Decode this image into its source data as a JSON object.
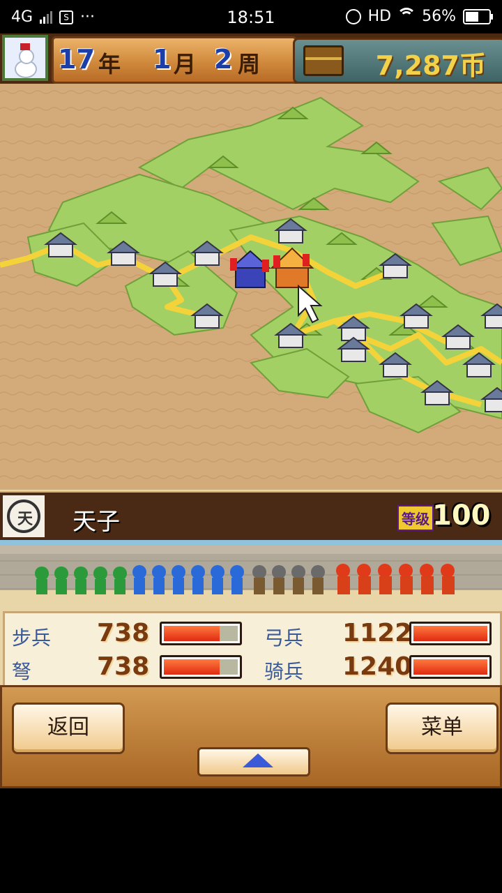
{
  "status_bar": {
    "network": "4G",
    "time": "18:51",
    "hd": "HD",
    "battery": "56%",
    "dots": "···",
    "sim_badge": "S"
  },
  "header": {
    "year_num": "17",
    "year_label": "年",
    "month_num": "1",
    "month_label": "月",
    "week_num": "2",
    "week_label": "周",
    "coins": "7,287币"
  },
  "lord": {
    "emblem_char": "天",
    "name": "天子",
    "rank_label": "等级",
    "rank_value": "100"
  },
  "stats": [
    {
      "label": "步兵",
      "value": "738",
      "fill": 0.75
    },
    {
      "label": "弓兵",
      "value": "1122",
      "fill": 1.0
    },
    {
      "label": "弩",
      "value": "738",
      "fill": 0.75
    },
    {
      "label": "骑兵",
      "value": "1240",
      "fill": 1.0
    }
  ],
  "controls": {
    "back_label": "返回",
    "menu_label": "菜单",
    "expand_icon": "up-triangle-icon"
  },
  "colors": {
    "accent_blue": "#1b3ea8",
    "panel_brown": "#4a2a14",
    "bar_red": "#e02a10",
    "terrain_green": "#9ccc5c",
    "road_yellow": "#f4d23a"
  }
}
